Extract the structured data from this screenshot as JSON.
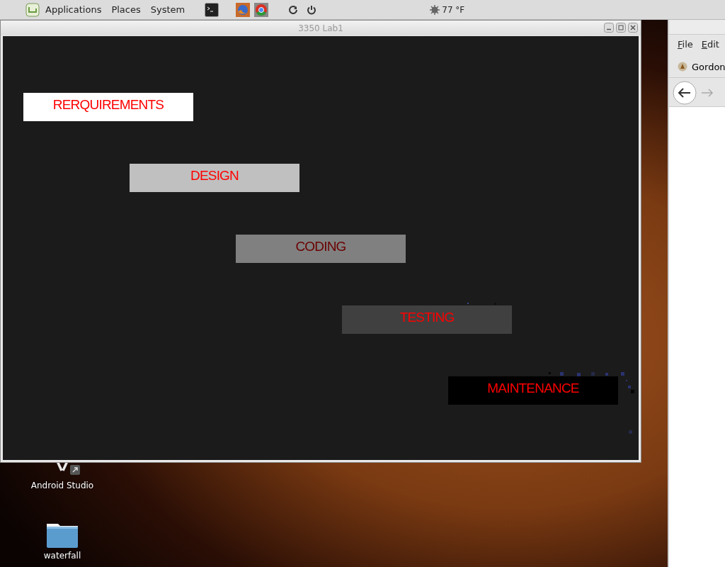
{
  "top_panel": {
    "menus": [
      "Applications",
      "Places",
      "System"
    ],
    "weather": "77 °F"
  },
  "window": {
    "title": "3350 Lab1",
    "steps": [
      {
        "label": "RERQUIREMENTS",
        "color": "#ffffff"
      },
      {
        "label": "DESIGN",
        "color": "#c0c0c0"
      },
      {
        "label": "CODING",
        "color": "#808080"
      },
      {
        "label": "TESTING",
        "color": "#404040"
      },
      {
        "label": "MAINTENANCE",
        "color": "#000000"
      }
    ]
  },
  "browser": {
    "menus": [
      "File",
      "Edit"
    ],
    "tab": "Gordon"
  },
  "desktop_icons": [
    {
      "label": "Android Studio",
      "kind": "app"
    },
    {
      "label": "waterfall",
      "kind": "folder"
    }
  ]
}
